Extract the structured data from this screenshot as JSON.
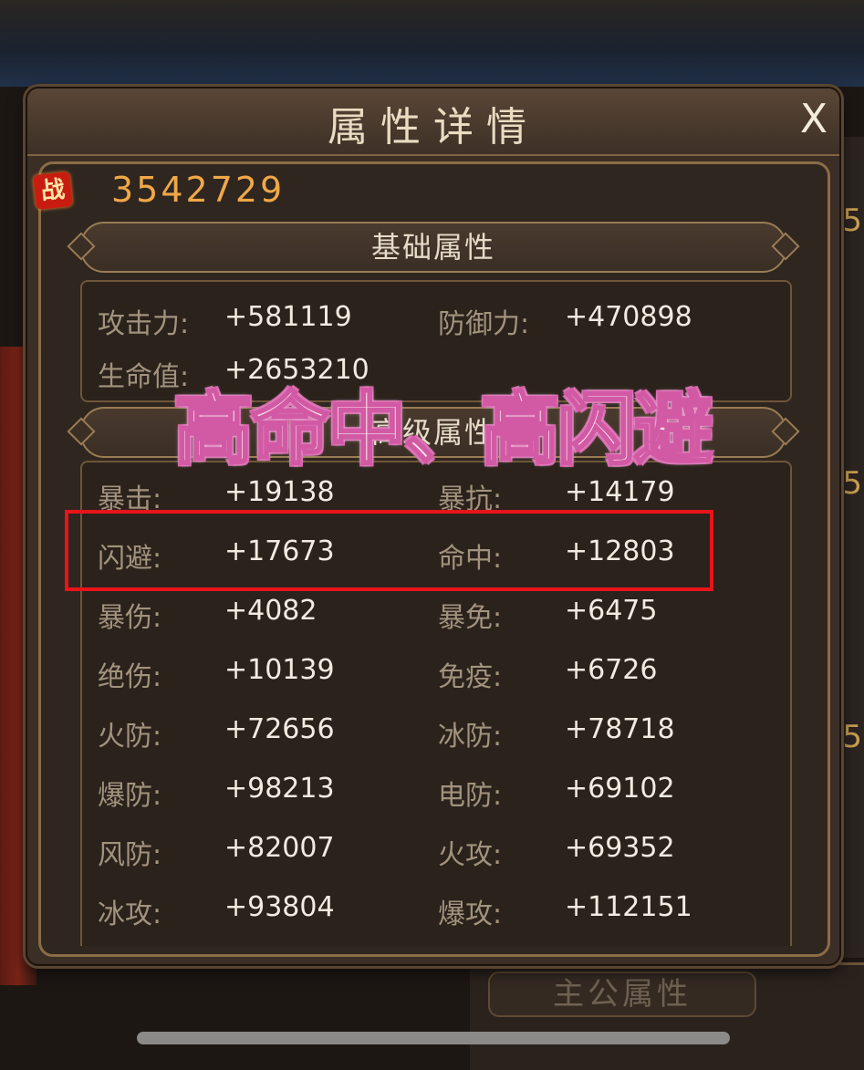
{
  "dialog": {
    "title": "属性详情",
    "close_label": "X"
  },
  "power": {
    "icon_label": "战",
    "value": "3542729"
  },
  "basic_section": {
    "title": "基础属性",
    "stats": [
      {
        "label": "攻击力:",
        "value": "+581119"
      },
      {
        "label": "防御力:",
        "value": "+470898"
      },
      {
        "label": "生命值:",
        "value": "+2653210"
      }
    ]
  },
  "advanced_section": {
    "title": "高级属性",
    "stats": [
      {
        "label": "暴击:",
        "value": "+19138"
      },
      {
        "label": "暴抗:",
        "value": "+14179"
      },
      {
        "label": "闪避:",
        "value": "+17673"
      },
      {
        "label": "命中:",
        "value": "+12803"
      },
      {
        "label": "暴伤:",
        "value": "+4082"
      },
      {
        "label": "暴免:",
        "value": "+6475"
      },
      {
        "label": "绝伤:",
        "value": "+10139"
      },
      {
        "label": "免疫:",
        "value": "+6726"
      },
      {
        "label": "火防:",
        "value": "+72656"
      },
      {
        "label": "冰防:",
        "value": "+78718"
      },
      {
        "label": "爆防:",
        "value": "+98213"
      },
      {
        "label": "电防:",
        "value": "+69102"
      },
      {
        "label": "风防:",
        "value": "+82007"
      },
      {
        "label": "火攻:",
        "value": "+69352"
      },
      {
        "label": "冰攻:",
        "value": "+93804"
      },
      {
        "label": "爆攻:",
        "value": "+112151"
      }
    ]
  },
  "overlay_caption": "高命中、高闪避",
  "background": {
    "side_numbers": [
      "5",
      "5",
      "5"
    ],
    "bottom_tab": "主公属性"
  },
  "colors": {
    "highlight_border": "#e8141a",
    "power_value": "#f0a848",
    "caption_stroke": "#d25aa5"
  }
}
